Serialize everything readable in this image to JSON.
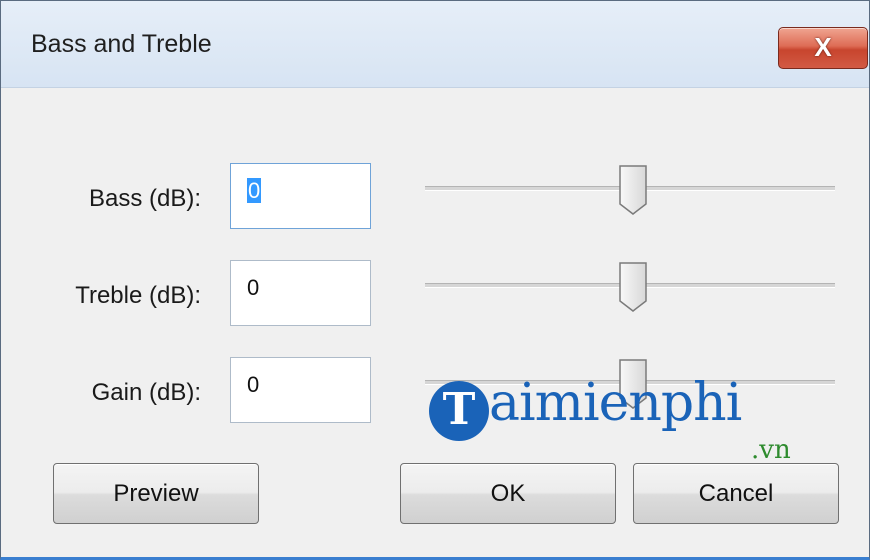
{
  "window": {
    "title": "Bass and Treble",
    "close_label": "X"
  },
  "rows": [
    {
      "label": "Bass (dB):",
      "value": "0",
      "slider_value": 0
    },
    {
      "label": "Treble (dB):",
      "value": "0",
      "slider_value": 0
    },
    {
      "label": "Gain (dB):",
      "value": "0",
      "slider_value": 0
    }
  ],
  "buttons": {
    "preview": "Preview",
    "ok": "OK",
    "cancel": "Cancel"
  },
  "watermark": {
    "logo_letter": "T",
    "text": "aimienphi",
    "tld": ".vn"
  },
  "colors": {
    "close_red": "#c8452e",
    "selection_blue": "#3399ff",
    "watermark_blue": "#1a63b8",
    "watermark_green": "#2e8b2e"
  }
}
